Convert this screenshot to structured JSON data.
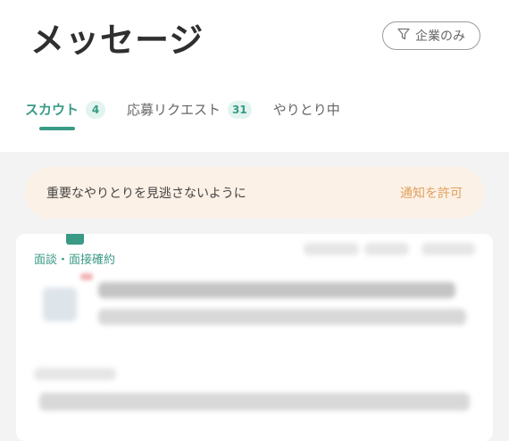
{
  "header": {
    "title": "メッセージ",
    "filter_label": "企業のみ",
    "filter_icon": "filter-icon"
  },
  "tabs": [
    {
      "label": "スカウト",
      "badge": "4",
      "active": true
    },
    {
      "label": "応募リクエスト",
      "badge": "31",
      "active": false
    },
    {
      "label": "やりとり中",
      "badge": "",
      "active": false
    }
  ],
  "notice": {
    "text": "重要なやりとりを見逃さないように",
    "link": "通知を許可"
  },
  "card": {
    "tag": "面談・面接確約"
  },
  "colors": {
    "accent": "#3a9a86",
    "notice_bg": "#fcf1e6",
    "notice_link": "#e0a15d"
  }
}
